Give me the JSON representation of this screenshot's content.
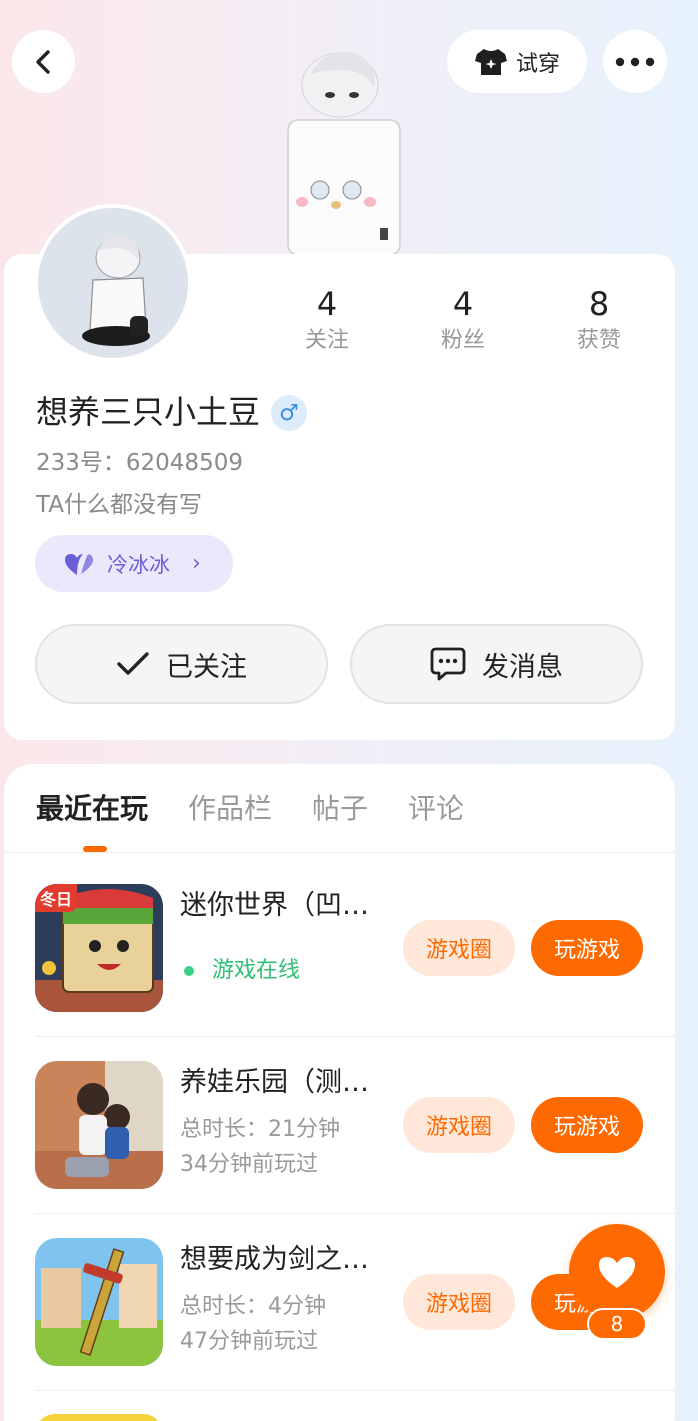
{
  "header": {
    "tryon_label": "试穿"
  },
  "stats": [
    {
      "num": "4",
      "label": "关注"
    },
    {
      "num": "4",
      "label": "粉丝"
    },
    {
      "num": "8",
      "label": "获赞"
    }
  ],
  "profile": {
    "username": "想养三只小土豆",
    "gender_symbol": "♂",
    "uid": "233号：62048509",
    "bio": "TA什么都没有写",
    "tag_label": "冷冰冰"
  },
  "actions": {
    "follow_label": "已关注",
    "message_label": "发消息"
  },
  "tabs": [
    "最近在玩",
    "作品栏",
    "帖子",
    "评论"
  ],
  "games": [
    {
      "title": "迷你世界（凹…",
      "status": "游戏在线",
      "circle_label": "游戏圈",
      "play_label": "玩游戏",
      "icon_badge": "冬日"
    },
    {
      "title": "养娃乐园（测…",
      "duration": "总时长：21分钟",
      "last_played": "34分钟前玩过",
      "circle_label": "游戏圈",
      "play_label": "玩游戏"
    },
    {
      "title": "想要成为剑之…",
      "duration": "总时长：4分钟",
      "last_played": "47分钟前玩过",
      "circle_label": "游戏圈",
      "play_label": "玩游戏"
    }
  ],
  "like": {
    "count": "8"
  },
  "colors": {
    "accent": "#ff6a00",
    "accent_light": "#ffe8da",
    "online_green": "#2fbf74",
    "tag_purple": "#6a5ed8"
  }
}
